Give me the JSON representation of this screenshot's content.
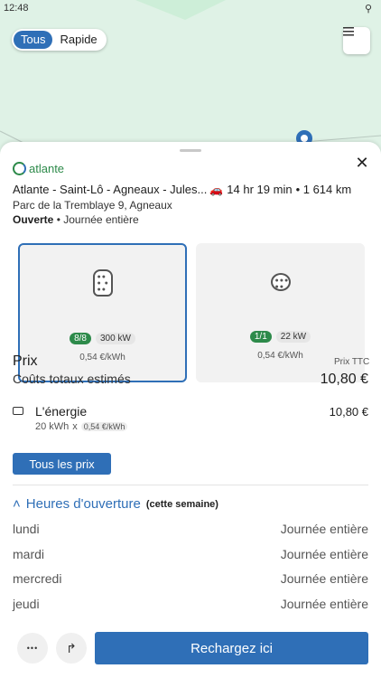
{
  "status_bar": {
    "time": "12:48",
    "location_icon": "location-icon"
  },
  "segment": {
    "options": [
      "Tous",
      "Rapide"
    ],
    "selected": "Tous"
  },
  "station": {
    "brand": "atlante",
    "name": "Atlante - Saint-Lô - Agneaux - Jules...",
    "travel_time": "14 hr 19 min",
    "distance": "• 1 614 km",
    "address": "Parc de la Tremblaye 9, Agneaux",
    "status": "Ouverte",
    "hours_summary": "• Journée entière"
  },
  "connectors": [
    {
      "availability": "8/8",
      "power": "300 kW",
      "price": "0,54 €/kWh",
      "type": "ccs",
      "selected": true
    },
    {
      "availability": "1/1",
      "power": "22 kW",
      "price": "0,54 €/kWh",
      "type": "type2",
      "selected": false
    }
  ],
  "pricing": {
    "title": "Prix",
    "ttc_label": "Prix TTC",
    "total_label": "Coûts totaux estimés",
    "total_value": "10,80 €",
    "energy_label": "L'énergie",
    "energy_qty": "20 kWh",
    "energy_times": "x",
    "energy_rate": "0,54 €/kWh",
    "energy_value": "10,80 €",
    "all_prices_button": "Tous les prix"
  },
  "hours": {
    "title": "Heures d'ouverture",
    "subtitle": "(cette semaine)",
    "rows": [
      {
        "day": "lundi",
        "value": "Journée entière"
      },
      {
        "day": "mardi",
        "value": "Journée entière"
      },
      {
        "day": "mercredi",
        "value": "Journée entière"
      },
      {
        "day": "jeudi",
        "value": "Journée entière"
      }
    ]
  },
  "bottom": {
    "more": "•••",
    "charge_button": "Rechargez ici"
  },
  "colors": {
    "accent": "#2f6fb7",
    "available": "#2d8a4a",
    "map": "#dff2e6"
  }
}
